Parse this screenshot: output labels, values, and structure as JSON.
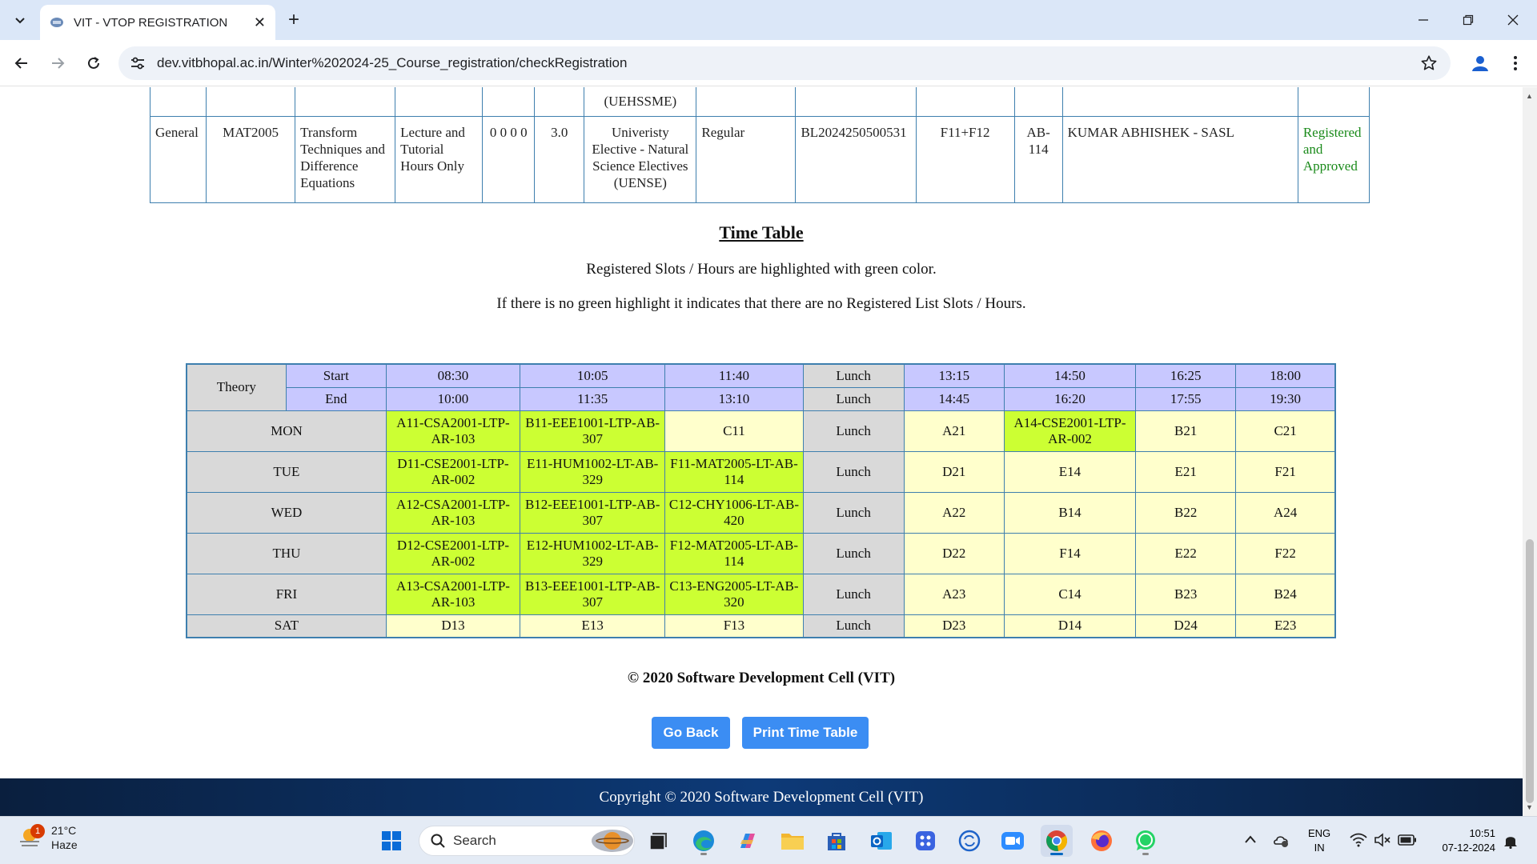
{
  "browser": {
    "tab_title": "VIT - VTOP REGISTRATION",
    "tab_close": "✕",
    "new_tab": "+",
    "url": "dev.vitbhopal.ac.in/Winter%202024-25_Course_registration/checkRegistration"
  },
  "registration": {
    "prev_row": {
      "course_type_tail": "(UEHSSME)"
    },
    "row": {
      "group": "General",
      "code": "MAT2005",
      "title": "Transform Techniques and Difference Equations",
      "type": "Lecture and Tutorial Hours Only",
      "ltpjc": "0 0 0 0",
      "credits": "3.0",
      "category": "Univeristy Elective - Natural Science Electives (UENSE)",
      "mode": "Regular",
      "class_no": "BL2024250500531",
      "slot": "F11+F12",
      "venue": "AB-114",
      "faculty": "KUMAR ABHISHEK - SASL",
      "status": "Registered and Approved"
    }
  },
  "timetable": {
    "heading": "Time Table",
    "note1": "Registered Slots / Hours are highlighted with green color.",
    "note2": "If there is no green highlight it indicates that there are no Registered List Slots / Hours.",
    "theory_label": "Theory",
    "start_label": "Start",
    "end_label": "End",
    "starts": [
      "08:30",
      "10:05",
      "11:40",
      "Lunch",
      "13:15",
      "14:50",
      "16:25",
      "18:00"
    ],
    "ends": [
      "10:00",
      "11:35",
      "13:10",
      "Lunch",
      "14:45",
      "16:20",
      "17:55",
      "19:30"
    ],
    "days": [
      {
        "day": "MON",
        "cells": [
          "A11-CSA2001-LTP-AR-103",
          "B11-EEE1001-LTP-AB-307",
          "C11",
          "Lunch",
          "A21",
          "A14-CSE2001-LTP-AR-002",
          "B21",
          "C21"
        ]
      },
      {
        "day": "TUE",
        "cells": [
          "D11-CSE2001-LTP-AR-002",
          "E11-HUM1002-LT-AB-329",
          "F11-MAT2005-LT-AB-114",
          "Lunch",
          "D21",
          "E14",
          "E21",
          "F21"
        ]
      },
      {
        "day": "WED",
        "cells": [
          "A12-CSA2001-LTP-AR-103",
          "B12-EEE1001-LTP-AB-307",
          "C12-CHY1006-LT-AB-420",
          "Lunch",
          "A22",
          "B14",
          "B22",
          "A24"
        ]
      },
      {
        "day": "THU",
        "cells": [
          "D12-CSE2001-LTP-AR-002",
          "E12-HUM1002-LT-AB-329",
          "F12-MAT2005-LT-AB-114",
          "Lunch",
          "D22",
          "F14",
          "E22",
          "F22"
        ]
      },
      {
        "day": "FRI",
        "cells": [
          "A13-CSA2001-LTP-AR-103",
          "B13-EEE1001-LTP-AB-307",
          "C13-ENG2005-LT-AB-320",
          "Lunch",
          "A23",
          "C14",
          "B23",
          "B24"
        ]
      },
      {
        "day": "SAT",
        "cells": [
          "D13",
          "E13",
          "F13",
          "Lunch",
          "D23",
          "D14",
          "D24",
          "E23"
        ]
      }
    ],
    "registered_color": "#ccff33",
    "free_color": "#ffffcc"
  },
  "page": {
    "copyright": "© 2020 Software Development Cell (VIT)",
    "go_back": "Go Back",
    "print": "Print Time Table",
    "footer": "Copyright © 2020 Software Development Cell (VIT)"
  },
  "taskbar": {
    "temp": "21°C",
    "condition": "Haze",
    "badge": "1",
    "search_label": "Search",
    "lang_line1": "ENG",
    "lang_line2": "IN",
    "time": "10:51",
    "date": "07-12-2024"
  }
}
